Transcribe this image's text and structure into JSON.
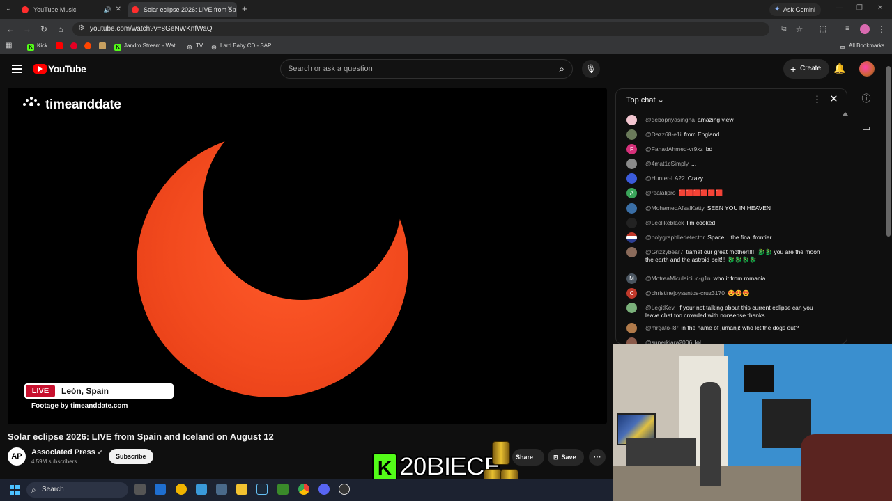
{
  "browser": {
    "tabs": [
      {
        "title": "YouTube Music",
        "active": false
      },
      {
        "title": "Solar eclipse 2026: LIVE from Sp",
        "active": true
      }
    ],
    "new_tab_icon": "plus-icon",
    "ask_gemini": "Ask Gemini",
    "url": "youtube.com/watch?v=8GeNWKnfWaQ",
    "bookmarks": [
      "Kick",
      "Jandro Stream - Wat...",
      "TV",
      "Lard Baby CD - SAP..."
    ],
    "all_bookmarks": "All Bookmarks"
  },
  "youtube": {
    "logo_text": "YouTube",
    "search_placeholder": "Search or ask a question",
    "create_label": "Create"
  },
  "video": {
    "watermark": "timeanddate",
    "live_badge": "LIVE",
    "location": "León, Spain",
    "footage": "Footage by timeanddate.com",
    "title": "Solar eclipse 2026: LIVE from Spain and Iceland on August 12",
    "channel": "Associated Press",
    "channel_initials": "AP",
    "subscribers": "4.59M subscribers",
    "subscribe_label": "Subscribe",
    "share_label": "Share",
    "save_label": "Save"
  },
  "overlay": {
    "kick_letter": "K",
    "kick_text": "20BIECE"
  },
  "chat": {
    "header": "Top chat",
    "messages": [
      {
        "user": "@debopriyasingha",
        "text": "amazing view",
        "avatar_color": "#f3c6d0",
        "initial": ""
      },
      {
        "user": "@Dazz68-e1i",
        "text": "from England",
        "avatar_color": "#6a7a5a",
        "initial": ""
      },
      {
        "user": "@FahadAhmed-vr9xz",
        "text": "bd",
        "avatar_color": "#d6307a",
        "initial": "F"
      },
      {
        "user": "@4mat1cSimply",
        "text": "...",
        "avatar_color": "#8a8a8a",
        "initial": ""
      },
      {
        "user": "@Hunter-LA22",
        "text": "Crazy",
        "avatar_color": "#3b5bdb",
        "initial": ""
      },
      {
        "user": "@realalipro",
        "text": "🟥🟥🟥🟥🟥🟥",
        "avatar_color": "#3aa55a",
        "initial": "A"
      },
      {
        "user": "@MohamedAfsalKatty",
        "text": "SEEN YOU IN HEAVEN",
        "avatar_color": "#3a6ea5",
        "initial": ""
      },
      {
        "user": "@Leolikeblack",
        "text": "I'm cooked",
        "avatar_color": "#222",
        "initial": ""
      },
      {
        "user": "@polygraphliedetector",
        "text": "Space... the final frontier...",
        "avatar_color": "#c0392b",
        "initial": ""
      },
      {
        "user": "@Grizzybear7",
        "text": "tiamat our great mother!!!!! 🐉🐉 you are the moon the earth and the astroid belt!!! 🐉🐉🐉🐉",
        "avatar_color": "#8a6a5a",
        "initial": ""
      },
      {
        "user": "@MotreaMiculaiciuc-g1n",
        "text": "who it from romania",
        "avatar_color": "#4a5560",
        "initial": "M"
      },
      {
        "user": "@christinejoysantos-cruz3170",
        "text": "😍😍😍",
        "avatar_color": "#c0392b",
        "initial": "C"
      },
      {
        "user": "@LegitKev.",
        "text": "if your not talking about this current eclipse can you leave chat too crowded with nonsense thanks",
        "avatar_color": "#7ab07a",
        "initial": ""
      },
      {
        "user": "@mrgato-l8r",
        "text": "in the name of jumanji! who let the dogs out?",
        "avatar_color": "#b07a4a",
        "initial": ""
      },
      {
        "user": "@superkiara2006",
        "text": "lol",
        "avatar_color": "#8a5a4a",
        "initial": ""
      }
    ]
  },
  "taskbar": {
    "search_label": "Search"
  }
}
